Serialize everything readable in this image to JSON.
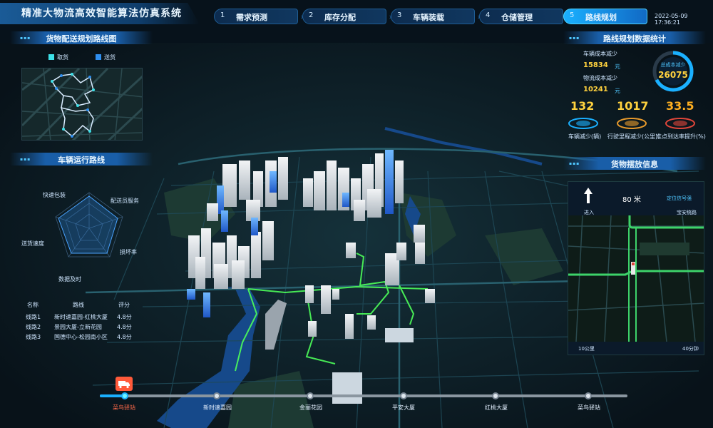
{
  "app_title": "精准大物流高效智能算法仿真系统",
  "steps": [
    {
      "num": "1",
      "label": "需求预测",
      "active": false
    },
    {
      "num": "2",
      "label": "库存分配",
      "active": false
    },
    {
      "num": "3",
      "label": "车辆装载",
      "active": false
    },
    {
      "num": "4",
      "label": "仓储管理",
      "active": false
    },
    {
      "num": "5",
      "label": "路线规划",
      "active": true
    }
  ],
  "datetime": "2022-05-09 17:36:21",
  "left_panel": {
    "delivery_map_title": "货物配送规划路线图",
    "legend": [
      {
        "label": "取货",
        "color": "#3de0e8"
      },
      {
        "label": "送货",
        "color": "#2f8ff0"
      }
    ],
    "vehicle_route_title": "车辆运行路线",
    "radar_axes": [
      "快速包装",
      "配送员服务",
      "损坏率",
      "数据及时",
      "送货速度"
    ],
    "table": {
      "headers": [
        "名称",
        "路线",
        "评分"
      ],
      "rows": [
        [
          "线路1",
          "新时速嘉园-红桃大厦",
          "4.8分"
        ],
        [
          "线路2",
          "景园大厦-立新花园",
          "4.8分"
        ],
        [
          "线路3",
          "国德中心-松园南小区",
          "4.8分"
        ]
      ]
    }
  },
  "right_panel": {
    "stats_title": "路线规划数据统计",
    "vehicle_cost_label": "车辆成本减少",
    "vehicle_cost_value": "15834",
    "logistics_cost_label": "物流成本减少",
    "logistics_cost_value": "10241",
    "unit_yuan": "元",
    "total_label": "总成本减少",
    "total_value": "26075",
    "indicators": [
      {
        "value": "132",
        "label": "车辆减少(辆)",
        "color": "#ffd23e"
      },
      {
        "value": "1017",
        "label": "行驶里程减少(公里)",
        "color": "#ffd23e"
      },
      {
        "value": "33.5",
        "label": "准点到达率提升(%)",
        "color": "#ffb020"
      }
    ],
    "cargo_title": "货物摆放信息",
    "nav": {
      "distance": "80 米",
      "signal_label": "定位信号强",
      "enter_label": "进入",
      "destination": "宝安统路",
      "bottom_left": "10公里",
      "bottom_right": "40分钟"
    }
  },
  "timeline": [
    "菜鸟驿站",
    "新时速嘉园",
    "金丽花园",
    "平安大厦",
    "红桃大厦",
    "菜鸟驿站"
  ],
  "colors": {
    "accent": "#1ab0ff",
    "route": "#4dff5a",
    "timeline_active": "#ff5a3a"
  }
}
